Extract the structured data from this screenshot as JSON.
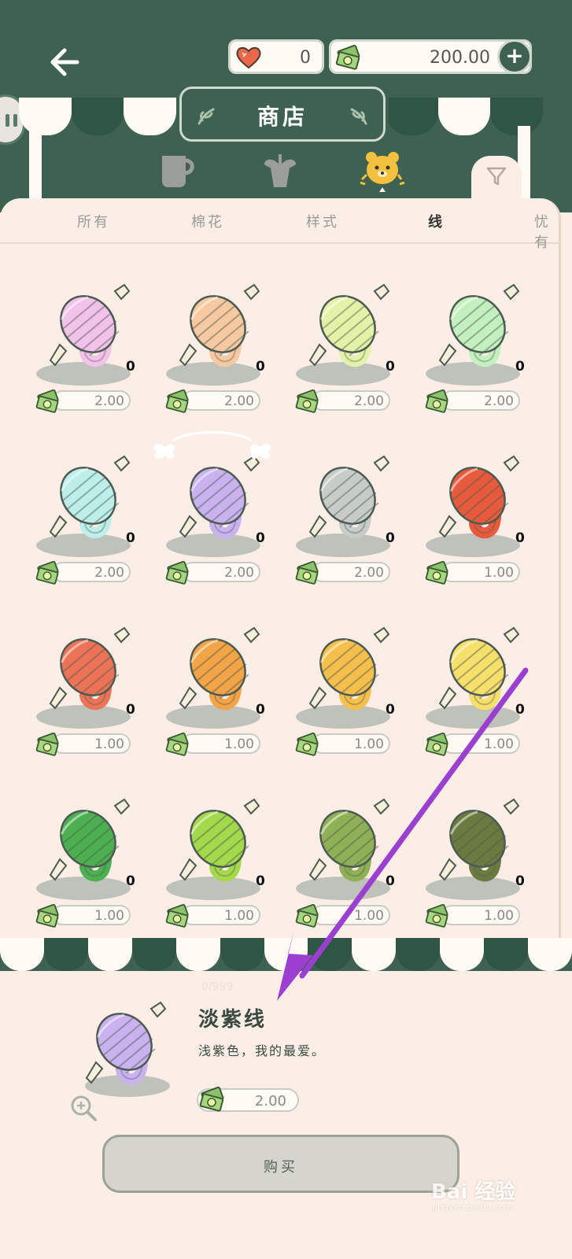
{
  "header": {
    "title": "商店",
    "hearts": "0",
    "money": "200.00",
    "plus_label": "+"
  },
  "category_tabs": [
    {
      "name": "cup-icon",
      "active": false
    },
    {
      "name": "plant-icon",
      "active": false
    },
    {
      "name": "bear-icon",
      "active": true
    }
  ],
  "subtabs": [
    {
      "label": "所有",
      "active": false
    },
    {
      "label": "棉花",
      "active": false
    },
    {
      "label": "样式",
      "active": false
    },
    {
      "label": "线",
      "active": true
    },
    {
      "label": "忧有",
      "active": false
    }
  ],
  "items": [
    {
      "color": "#f2c2ea",
      "count": "0",
      "price": "2.00"
    },
    {
      "color": "#f6c9a0",
      "count": "0",
      "price": "2.00"
    },
    {
      "color": "#e4f2a8",
      "count": "0",
      "price": "2.00"
    },
    {
      "color": "#c4efbe",
      "count": "0",
      "price": "2.00"
    },
    {
      "color": "#bdeee9",
      "count": "0",
      "price": "2.00"
    },
    {
      "color": "#c9b2ef",
      "count": "0",
      "price": "2.00"
    },
    {
      "color": "#c8ccc8",
      "count": "0",
      "price": "2.00"
    },
    {
      "color": "#e85a3c",
      "count": "0",
      "price": "1.00"
    },
    {
      "color": "#ec7356",
      "count": "0",
      "price": "1.00"
    },
    {
      "color": "#f2a446",
      "count": "0",
      "price": "1.00"
    },
    {
      "color": "#f5bf4c",
      "count": "0",
      "price": "1.00"
    },
    {
      "color": "#f6df6a",
      "count": "0",
      "price": "1.00"
    },
    {
      "color": "#4caf50",
      "count": "0",
      "price": "1.00"
    },
    {
      "color": "#a3d94a",
      "count": "0",
      "price": "1.00"
    },
    {
      "color": "#8fb055",
      "count": "0",
      "price": "1.00"
    },
    {
      "color": "#6b7b40",
      "count": "0",
      "price": "1.00"
    }
  ],
  "detail": {
    "ghost": "0/999",
    "name": "淡紫线",
    "description": "浅紫色，我的最爱。",
    "price": "2.00",
    "color": "#c9b2ef",
    "buy_label": "购买"
  },
  "watermark": {
    "brand": "Bai 经验",
    "url": "jingyan.baidu.com"
  },
  "colors": {
    "dark_green": "#3f6152",
    "cream": "#fbeee6",
    "arrow": "#9b3fd0"
  }
}
